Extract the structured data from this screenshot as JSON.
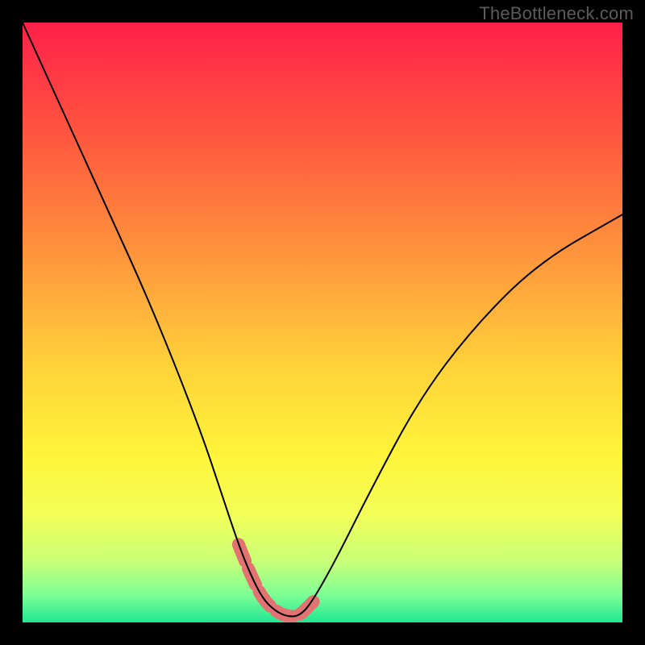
{
  "watermark": "TheBottleneck.com",
  "chart_data": {
    "type": "line",
    "title": "",
    "xlabel": "",
    "ylabel": "",
    "xlim": [
      0,
      100
    ],
    "ylim": [
      0,
      100
    ],
    "grid": false,
    "series": [
      {
        "name": "bottleneck-curve",
        "x": [
          0,
          5,
          10,
          15,
          20,
          25,
          30,
          33,
          36,
          38,
          40,
          42,
          44,
          46,
          48,
          52,
          58,
          66,
          75,
          86,
          100
        ],
        "y": [
          100,
          89,
          78,
          67,
          56,
          44,
          31,
          22,
          13,
          8,
          4,
          2,
          1,
          1,
          3,
          10,
          22,
          37,
          49,
          60,
          68
        ],
        "color": "#000000",
        "line_width": 2
      }
    ],
    "highlights": [
      {
        "name": "trough-dashes",
        "color": "#e37272",
        "stroke_width": 16,
        "dash": [
          22,
          10
        ],
        "x": [
          36,
          38,
          40,
          42,
          44,
          46,
          48,
          49
        ],
        "y": [
          13,
          8,
          4,
          2,
          1,
          1,
          3,
          4
        ]
      }
    ],
    "background": {
      "type": "vertical-gradient",
      "stops": [
        {
          "offset": 0.0,
          "color": "#ff2049"
        },
        {
          "offset": 0.2,
          "color": "#ff5a3f"
        },
        {
          "offset": 0.4,
          "color": "#ff993c"
        },
        {
          "offset": 0.58,
          "color": "#ffd43a"
        },
        {
          "offset": 0.72,
          "color": "#fff43a"
        },
        {
          "offset": 0.82,
          "color": "#f3ff58"
        },
        {
          "offset": 0.9,
          "color": "#c7ff78"
        },
        {
          "offset": 0.955,
          "color": "#7cff95"
        },
        {
          "offset": 1.0,
          "color": "#20e694"
        }
      ]
    }
  }
}
